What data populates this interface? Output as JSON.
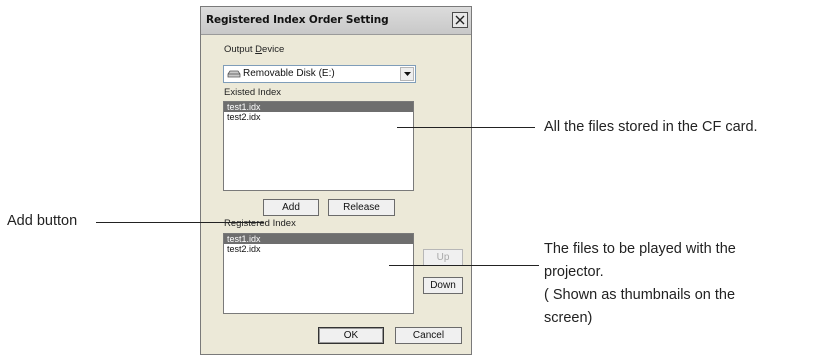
{
  "dialog": {
    "title": "Registered Index Order Setting",
    "close_icon": "close-icon",
    "output_device_label": "Output Device",
    "output_device_value": "Removable Disk (E:)",
    "existed_index_label": "Existed Index",
    "existed_index_items": [
      "test1.idx",
      "test2.idx"
    ],
    "add_label": "Add",
    "release_label": "Release",
    "registered_index_label": "Registered Index",
    "registered_index_items": [
      "test1.idx",
      "test2.idx"
    ],
    "up_label": "Up",
    "down_label": "Down",
    "ok_label": "OK",
    "cancel_label": "Cancel"
  },
  "annotations": {
    "add_button": "Add button",
    "files_stored": "All the files stored in the CF card.",
    "files_played_1": "The files to be played with the",
    "files_played_2": "projector.",
    "files_played_3": "( Shown as thumbnails on the",
    "files_played_4": "screen)"
  }
}
